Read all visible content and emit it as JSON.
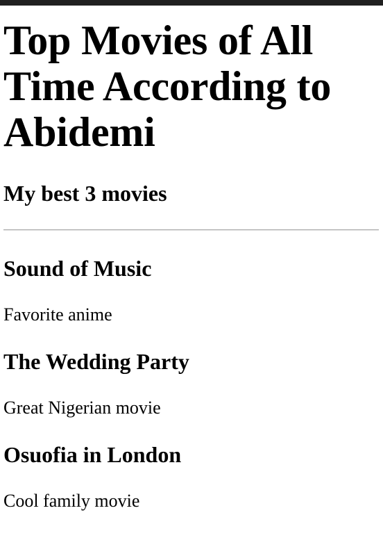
{
  "header": {
    "title": "Top Movies of All Time According to Abidemi",
    "subtitle": "My best 3 movies"
  },
  "movies": [
    {
      "title": "Sound of Music",
      "description": "Favorite anime"
    },
    {
      "title": "The Wedding Party",
      "description": "Great Nigerian movie"
    },
    {
      "title": "Osuofia in London",
      "description": "Cool family movie"
    }
  ],
  "colors": {
    "top_bar": "#202020",
    "background": "#ffffff",
    "text": "#000000",
    "divider": "#a8a8a8"
  }
}
